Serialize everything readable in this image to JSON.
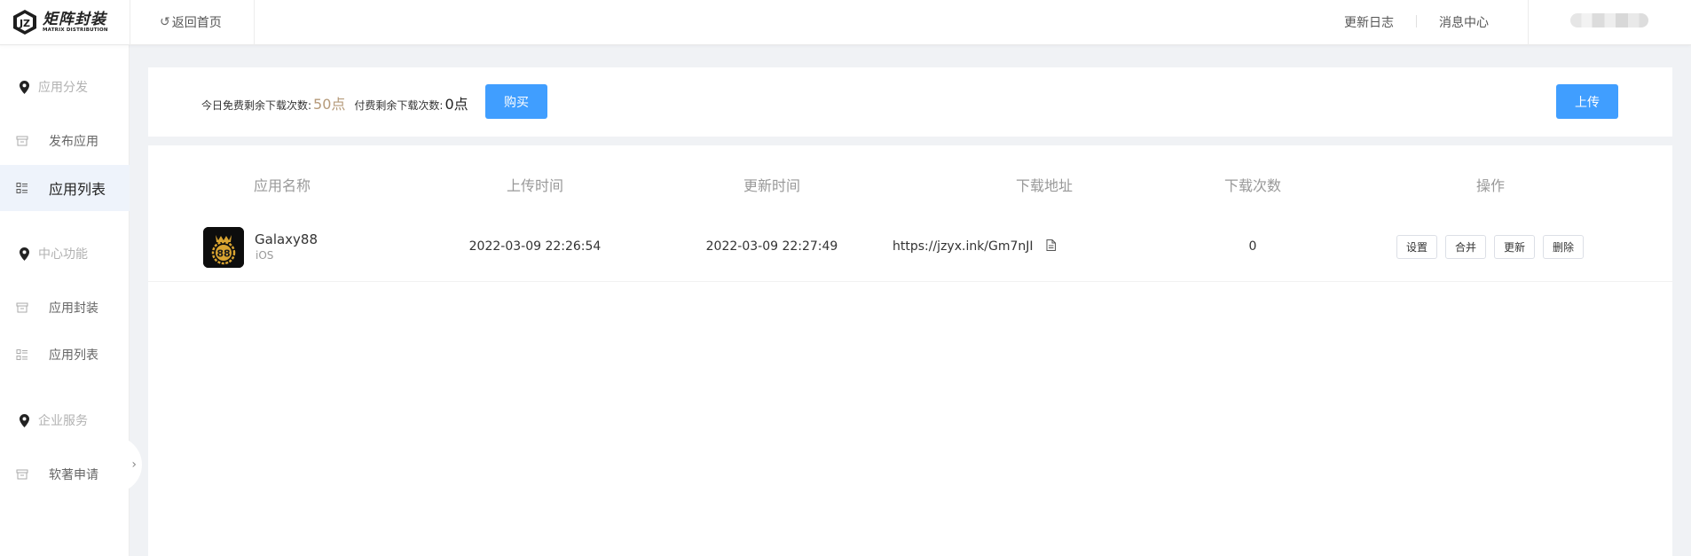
{
  "header": {
    "logo_cn": "矩阵封装",
    "logo_en": "MATRIX DISTRIBUTION",
    "back_home": "返回首页",
    "changelog": "更新日志",
    "messages": "消息中心"
  },
  "sidebar": {
    "groups": [
      {
        "title": "应用分发",
        "items": [
          {
            "label": "发布应用"
          },
          {
            "label": "应用列表",
            "active": true
          }
        ]
      },
      {
        "title": "中心功能",
        "items": [
          {
            "label": "应用封装"
          },
          {
            "label": "应用列表"
          }
        ]
      },
      {
        "title": "企业服务",
        "items": [
          {
            "label": "软著申请"
          }
        ]
      }
    ]
  },
  "quota": {
    "free_label": "今日免费剩余下载次数:",
    "free_value": "50点",
    "paid_label": "付费剩余下载次数:",
    "paid_value": "0点",
    "buy_label": "购买",
    "upload_label": "上传"
  },
  "table": {
    "columns": [
      "应用名称",
      "上传时间",
      "更新时间",
      "下载地址",
      "下载次数",
      "操作"
    ],
    "rows": [
      {
        "name": "Galaxy88",
        "platform": "iOS",
        "icon_text": "88",
        "upload_time": "2022-03-09 22:26:54",
        "update_time": "2022-03-09 22:27:49",
        "url": "https://jzyx.ink/Gm7nJI",
        "downloads": "0",
        "actions": [
          "设置",
          "合并",
          "更新",
          "删除"
        ]
      }
    ]
  },
  "colors": {
    "primary": "#409eff",
    "free_value": "#b59a7a",
    "active_bg": "#eef3fb",
    "icon_gold": "#d9a431"
  }
}
